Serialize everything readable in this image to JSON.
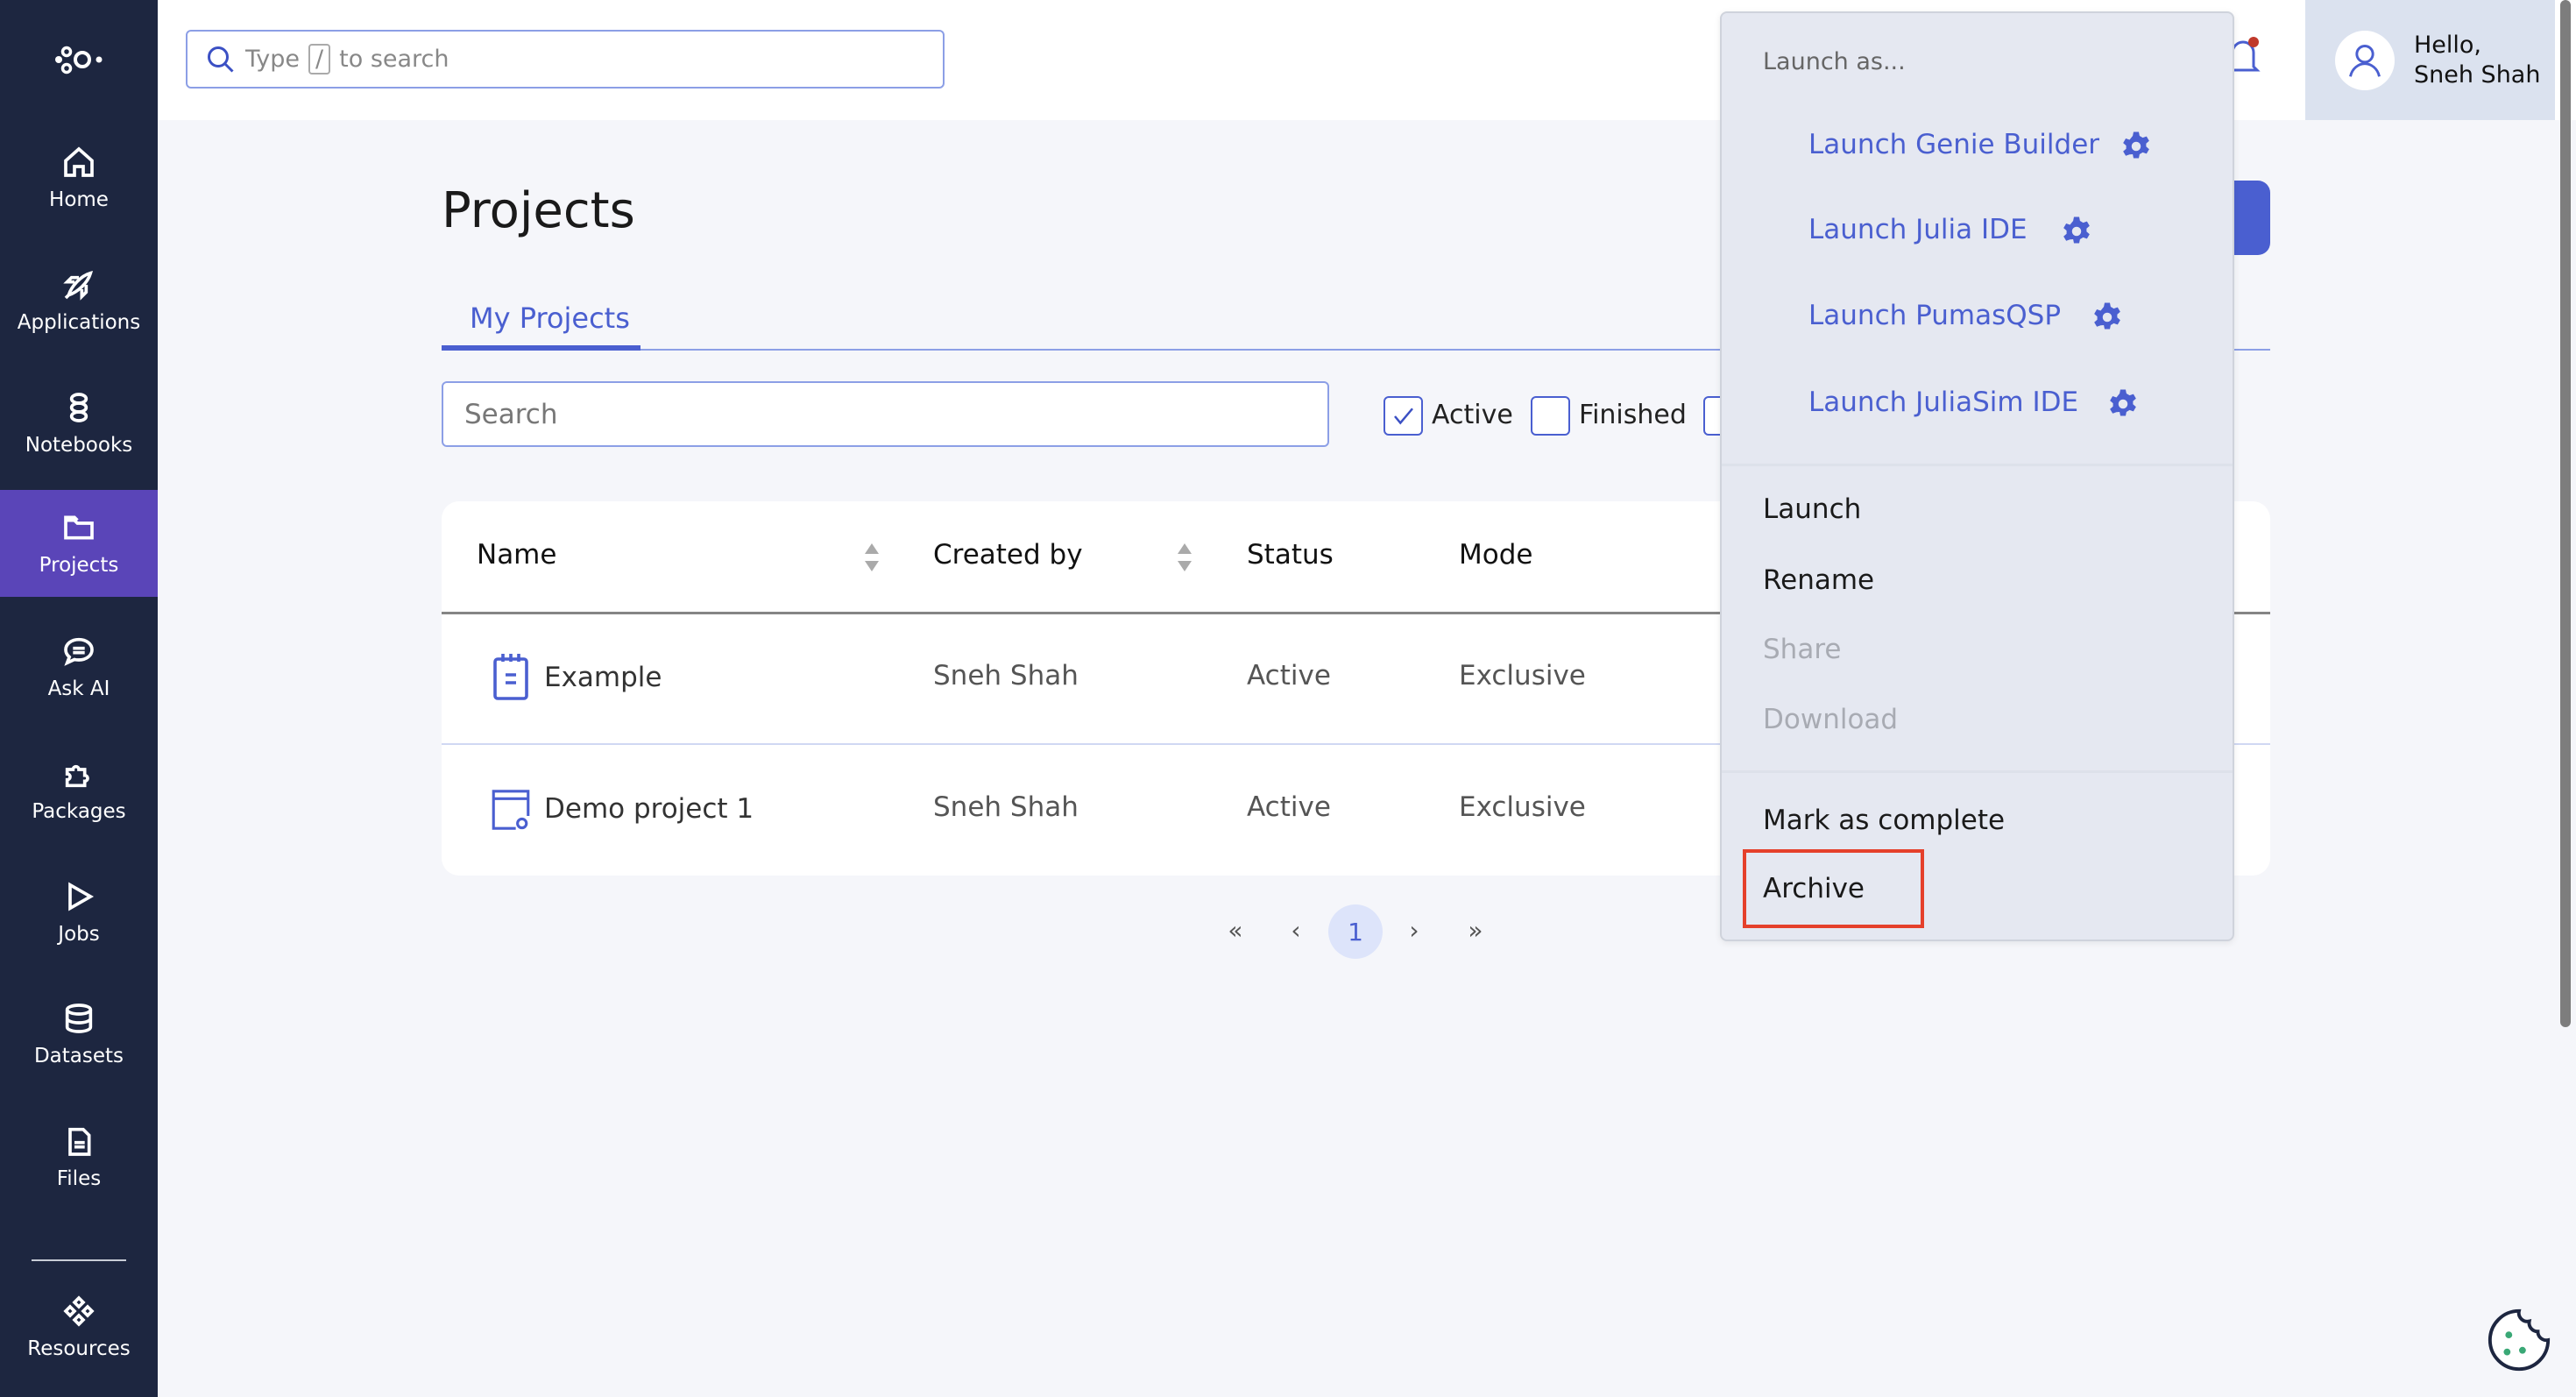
{
  "sidebar": {
    "items": [
      {
        "label": "Home",
        "icon": "home-icon"
      },
      {
        "label": "Applications",
        "icon": "rocket-icon"
      },
      {
        "label": "Notebooks",
        "icon": "notebook-icon"
      },
      {
        "label": "Projects",
        "icon": "folder-icon",
        "active": true
      },
      {
        "label": "Ask AI",
        "icon": "chat-icon"
      },
      {
        "label": "Packages",
        "icon": "puzzle-icon"
      },
      {
        "label": "Jobs",
        "icon": "play-icon"
      },
      {
        "label": "Datasets",
        "icon": "database-icon"
      },
      {
        "label": "Files",
        "icon": "files-icon"
      },
      {
        "label": "Resources",
        "icon": "resources-icon"
      }
    ]
  },
  "header": {
    "search_prefix": "Type",
    "search_key": "/",
    "search_suffix": "to search",
    "greeting": "Hello,",
    "user_name": "Sneh Shah"
  },
  "page": {
    "title": "Projects",
    "tab": "My Projects",
    "search_placeholder": "Search",
    "filters": [
      {
        "label": "Active",
        "checked": true
      },
      {
        "label": "Finished",
        "checked": false
      }
    ]
  },
  "table": {
    "columns": [
      "Name",
      "Created by",
      "Status",
      "Mode"
    ],
    "rows": [
      {
        "name": "Example",
        "created_by": "Sneh Shah",
        "status": "Active",
        "mode": "Exclusive",
        "icon": "notepad-icon"
      },
      {
        "name": "Demo project 1",
        "created_by": "Sneh Shah",
        "status": "Active",
        "mode": "Exclusive",
        "icon": "app-window-gear-icon"
      }
    ]
  },
  "pagination": {
    "first": "«",
    "prev": "‹",
    "current": "1",
    "next": "›",
    "last": "»"
  },
  "menu": {
    "header": "Launch as...",
    "launch_items": [
      "Launch Genie Builder",
      "Launch Julia IDE",
      "Launch PumasQSP",
      "Launch JuliaSim IDE"
    ],
    "actions": [
      {
        "label": "Launch",
        "disabled": false
      },
      {
        "label": "Rename",
        "disabled": false
      },
      {
        "label": "Share",
        "disabled": true
      },
      {
        "label": "Download",
        "disabled": true
      }
    ],
    "footer": [
      "Mark as complete",
      "Archive"
    ]
  },
  "colors": {
    "accent": "#4a5fd0",
    "sidebar": "#1d2640",
    "sidebar_active": "#5a45b8",
    "highlight": "#e5402b"
  }
}
